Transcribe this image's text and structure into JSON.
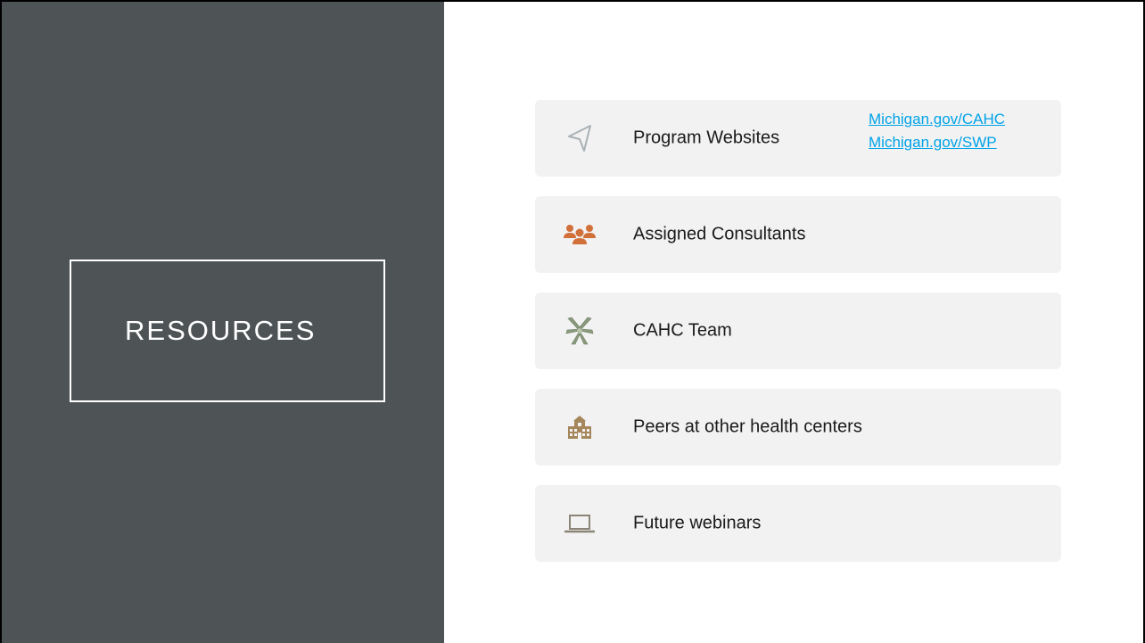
{
  "slide": {
    "title": "RESOURCES"
  },
  "resources": [
    {
      "label": "Program Websites",
      "icon": "navigation-arrow-icon",
      "icon_color": "#a9b1b6",
      "links": [
        "Michigan.gov/CAHC",
        "Michigan.gov/SWP"
      ]
    },
    {
      "label": "Assigned Consultants",
      "icon": "people-group-icon",
      "icon_color": "#d2703a"
    },
    {
      "label": "CAHC Team",
      "icon": "team-hands-icon",
      "icon_color": "#8a9a7d"
    },
    {
      "label": "Peers at other health centers",
      "icon": "school-building-icon",
      "icon_color": "#a6875c"
    },
    {
      "label": "Future webinars",
      "icon": "laptop-icon",
      "icon_color": "#8c8577"
    }
  ],
  "colors": {
    "panel": "#4e5456",
    "card": "#f2f2f2",
    "link": "#00a3e8"
  }
}
